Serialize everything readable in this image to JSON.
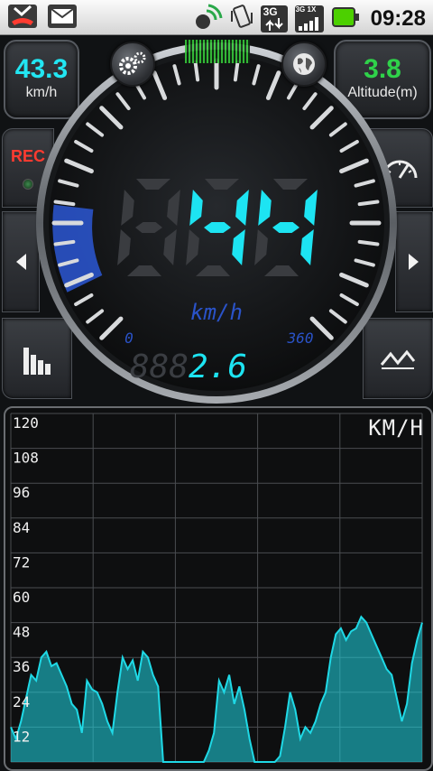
{
  "status_bar": {
    "time": "09:28",
    "network_badge": "3G",
    "network_badge2": "3G 1X"
  },
  "left_panel": {
    "speed": "43.3",
    "unit": "km/h"
  },
  "right_panel": {
    "altitude": "3.8",
    "label": "Altitude(m)"
  },
  "rec_button": {
    "label": "REC"
  },
  "gauge": {
    "speed_display": "44",
    "unit": "km/h",
    "scale_min": "0",
    "scale_max": "360",
    "odometer": "2.6",
    "odometer_ghost": "888"
  },
  "chart_data": {
    "type": "area",
    "unit_label": "KM/H",
    "ylim": [
      0,
      120
    ],
    "y_ticks": [
      "120",
      "108",
      "96",
      "84",
      "72",
      "60",
      "48",
      "36",
      "24",
      "12"
    ],
    "grid": true,
    "color": "#1fd9e6",
    "values": [
      12,
      8,
      14,
      22,
      30,
      28,
      36,
      38,
      33,
      34,
      30,
      26,
      20,
      18,
      10,
      28,
      25,
      24,
      20,
      14,
      10,
      24,
      36,
      32,
      35,
      28,
      38,
      36,
      30,
      26,
      0,
      0,
      0,
      0,
      0,
      0,
      0,
      0,
      0,
      4,
      10,
      28,
      24,
      30,
      20,
      26,
      18,
      8,
      0,
      0,
      0,
      0,
      0,
      2,
      12,
      24,
      18,
      8,
      12,
      10,
      14,
      20,
      24,
      36,
      44,
      46,
      42,
      45,
      46,
      50,
      48,
      44,
      40,
      36,
      32,
      30,
      22,
      14,
      20,
      34,
      42,
      48
    ],
    "values_max": 120
  },
  "colors": {
    "accent": "#22e6f2",
    "altitude": "#2fd24a",
    "rec": "#ff3b30",
    "gauge_zone": "#2a53c9"
  }
}
